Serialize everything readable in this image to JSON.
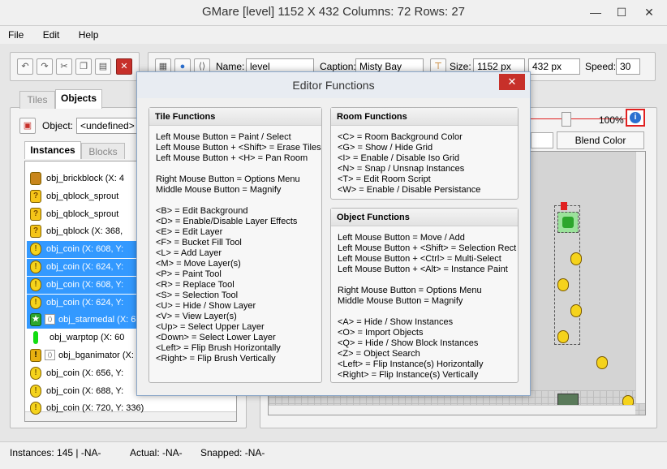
{
  "window": {
    "title": "GMare [level] 1152 X 432 Columns: 72 Rows: 27",
    "minimize": "—",
    "maximize": "☐",
    "close": "✕"
  },
  "menu": [
    "File",
    "Edit",
    "Help"
  ],
  "room_toolbar": {
    "name_label": "Name:",
    "name_value": "level",
    "caption_label": "Caption:",
    "caption_value": "Misty Bay",
    "size_label": "Size:",
    "width_value": "1152 px",
    "height_value": "432 px",
    "speed_label": "Speed:",
    "speed_value": "30"
  },
  "left_panel": {
    "tabs": [
      "Tiles",
      "Objects"
    ],
    "object_label": "Object:",
    "object_value": "<undefined>",
    "subtabs": [
      "Instances",
      "Blocks"
    ],
    "instances": [
      {
        "icon": "brick",
        "text": "obj_brickblock (X: 4",
        "selected": false
      },
      {
        "icon": "qblock",
        "text": "obj_qblock_sprout",
        "selected": false
      },
      {
        "icon": "qblock",
        "text": "obj_qblock_sprout",
        "selected": false
      },
      {
        "icon": "qblock",
        "text": "obj_qblock (X: 368,",
        "selected": false
      },
      {
        "icon": "coin",
        "text": "obj_coin (X: 608, Y:",
        "selected": true
      },
      {
        "icon": "coin",
        "text": "obj_coin (X: 624, Y:",
        "selected": true
      },
      {
        "icon": "coin",
        "text": "obj_coin (X: 608, Y:",
        "selected": true
      },
      {
        "icon": "coin",
        "text": "obj_coin (X: 624, Y:",
        "selected": true
      },
      {
        "icon": "star",
        "text": "obj_starmedal (X: 6",
        "selected": true
      },
      {
        "icon": "warp",
        "text": "obj_warptop (X: 60",
        "selected": false
      },
      {
        "icon": "excl",
        "text": "obj_bganimator (X:",
        "selected": false
      },
      {
        "icon": "coin",
        "text": "obj_coin (X: 656, Y:",
        "selected": false
      },
      {
        "icon": "coin",
        "text": "obj_coin (X: 688, Y:",
        "selected": false
      },
      {
        "icon": "coin",
        "text": "obj_coin (X: 720, Y: 336)",
        "selected": false
      }
    ]
  },
  "view_bar": {
    "zoom": "100%",
    "blend_button": "Blend Color"
  },
  "dialog": {
    "title": "Editor Functions",
    "close": "✕",
    "tile_functions": {
      "header": "Tile Functions",
      "lines": [
        "Left Mouse Button = Paint / Select",
        "Left Mouse Button + <Shift> = Erase Tiles",
        "Left Mouse Button + <H> = Pan Room",
        "",
        "Right Mouse Button = Options Menu",
        "Middle Mouse Button = Magnify",
        "",
        "<B> = Edit Background",
        "<D> = Enable/Disable Layer Effects",
        "<E> = Edit Layer",
        "<F> = Bucket Fill Tool",
        "<L> = Add Layer",
        "<M> = Move Layer(s)",
        "<P> = Paint Tool",
        "<R> = Replace Tool",
        "<S> = Selection Tool",
        "<U> = Hide / Show Layer",
        "<V> = View Layer(s)",
        "<Up> = Select Upper Layer",
        "<Down> = Select Lower Layer",
        "<Left> = Flip Brush Horizontally",
        "<Right> = Flip Brush Vertically"
      ]
    },
    "room_functions": {
      "header": "Room Functions",
      "lines": [
        "<C> = Room Background Color",
        "<G> = Show / Hide Grid",
        "<I> = Enable / Disable Iso Grid",
        "<N> = Snap / Unsnap Instances",
        "<T> = Edit Room Script",
        "<W> = Enable / Disable Persistance"
      ]
    },
    "object_functions": {
      "header": "Object Functions",
      "lines": [
        "Left Mouse Button = Move / Add",
        "Left Mouse Button + <Shift> = Selection Rect",
        "Left Mouse Button + <Ctrl> = Multi-Select",
        "Left Mouse Button + <Alt> = Instance Paint",
        "",
        "Right Mouse Button = Options Menu",
        "Middle Mouse Button = Magnify",
        "",
        "<A> = Hide / Show Instances",
        "<O> = Import Objects",
        "<Q> = Hide / Show Block Instances",
        "<Z> = Object Search",
        "<Left> = Flip Instance(s) Horizontally",
        "<Right> = Flip Instance(s) Vertically"
      ]
    }
  },
  "status_bar": {
    "instances": "Instances: 145 | -NA-",
    "actual": "Actual: -NA-",
    "snapped": "Snapped: -NA-"
  },
  "colors": {
    "selection": "#3399ff",
    "close_red": "#c7302a",
    "highlight_box": "#e02020"
  },
  "icons": [
    "undo-icon",
    "redo-icon",
    "cut-icon",
    "copy-icon",
    "paste-icon",
    "delete-icon",
    "grid-icon",
    "globe-icon",
    "script-icon",
    "resize-icon",
    "info-icon"
  ]
}
